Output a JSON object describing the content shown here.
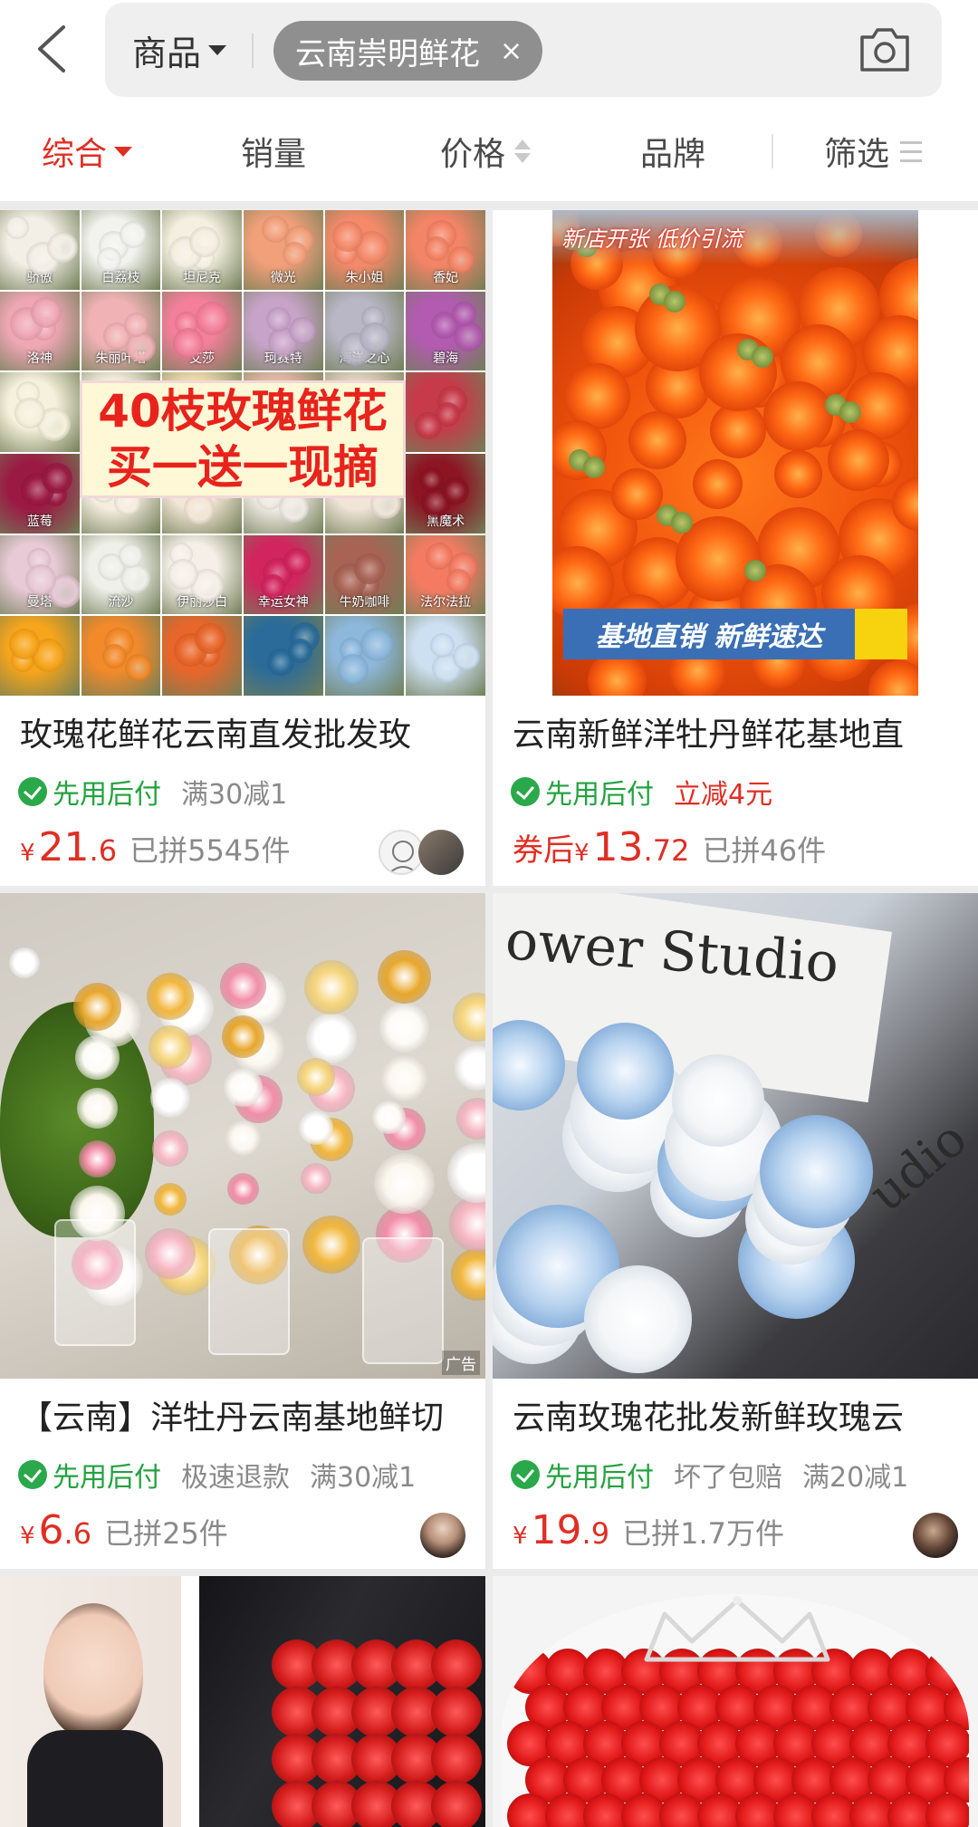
{
  "search": {
    "scope_label": "商品",
    "query_tag": "云南崇明鲜花",
    "clear_icon": "×"
  },
  "sort_bar": {
    "comprehensive": "综合",
    "sales": "销量",
    "price": "价格",
    "brand": "品牌",
    "filter": "筛选"
  },
  "products": [
    {
      "title": "玫瑰花鲜花云南直发批发玫",
      "pay_badge": "先用后付",
      "tags": [
        "满30减1"
      ],
      "price_prefix": "",
      "price_yen": "¥",
      "price_int": "21",
      "price_dec": ".6",
      "sold": "已拼5545件",
      "image": {
        "headline1": "40枝玫瑰鲜花",
        "headline2": "买一送一现摘",
        "variety_labels": [
          "骄傲",
          "白荔枝",
          "坦尼克",
          "微光",
          "朱小姐",
          "香妃",
          "洛神",
          "朱丽叶塔",
          "艾莎",
          "珂赛特",
          "海洋之心",
          "碧海",
          "",
          "",
          "",
          "",
          "",
          "",
          "蓝莓",
          "",
          "",
          "",
          "",
          "黑魔术",
          "曼塔",
          "流沙",
          "伊丽莎白",
          "幸运女神",
          "牛奶咖啡",
          "法尔法拉"
        ]
      }
    },
    {
      "title": "云南新鲜洋牡丹鲜花基地直",
      "pay_badge": "先用后付",
      "tags": [
        "立减4元"
      ],
      "price_prefix": "券后",
      "price_yen": "¥",
      "price_int": "13",
      "price_dec": ".72",
      "sold": "已拼46件",
      "image": {
        "top_text": "新店开张  低价引流",
        "banner": "基地直销  新鲜速达"
      }
    },
    {
      "title": "【云南】洋牡丹云南基地鲜切",
      "pay_badge": "先用后付",
      "tags": [
        "极速退款",
        "满30减1"
      ],
      "price_prefix": "",
      "price_yen": "¥",
      "price_int": "6",
      "price_dec": ".6",
      "sold": "已拼25件",
      "ad_label": "广告"
    },
    {
      "title": "云南玫瑰花批发新鲜玫瑰云",
      "pay_badge": "先用后付",
      "tags": [
        "坏了包赔",
        "满20减1"
      ],
      "price_prefix": "",
      "price_yen": "¥",
      "price_int": "19",
      "price_dec": ".9",
      "sold": "已拼1.7万件",
      "image": {
        "studio_text": "ower Studio",
        "studio_text2": "udio"
      }
    }
  ],
  "colors": {
    "accent": "#e02e24",
    "pay_green": "#23a23f"
  }
}
